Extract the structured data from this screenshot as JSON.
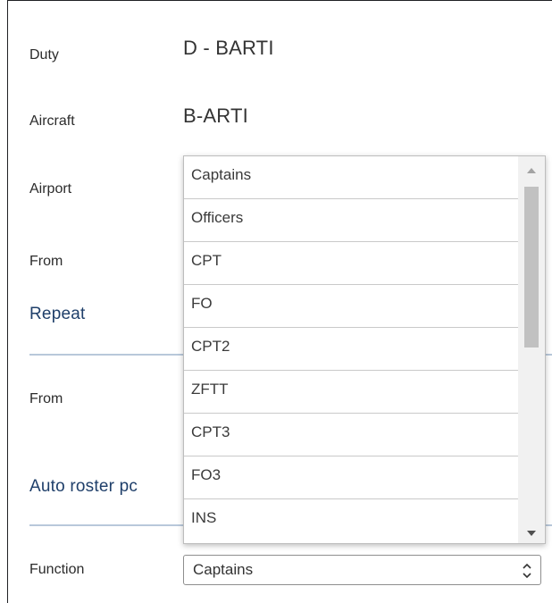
{
  "form": {
    "duty_label": "Duty",
    "duty_value": "D - BARTI",
    "aircraft_label": "Aircraft",
    "aircraft_value": "B-ARTI",
    "airport_label": "Airport",
    "from_label": "From",
    "repeat_section": "Repeat",
    "repeat_from_label": "From",
    "auto_roster_section": "Auto roster pc",
    "function_label": "Function",
    "function_selected": "Captains"
  },
  "dropdown": {
    "options": [
      "Captains",
      "Officers",
      "CPT",
      "FO",
      "CPT2",
      "ZFTT",
      "CPT3",
      "FO3",
      "INS"
    ]
  },
  "icons": {
    "select_chevron": "chevron-up-down-icon",
    "scroll_up": "scroll-up-arrow-icon",
    "scroll_down": "scroll-down-arrow-icon"
  },
  "colors": {
    "section_heading": "#1f3f6a",
    "section_rule": "#b8c8da"
  }
}
